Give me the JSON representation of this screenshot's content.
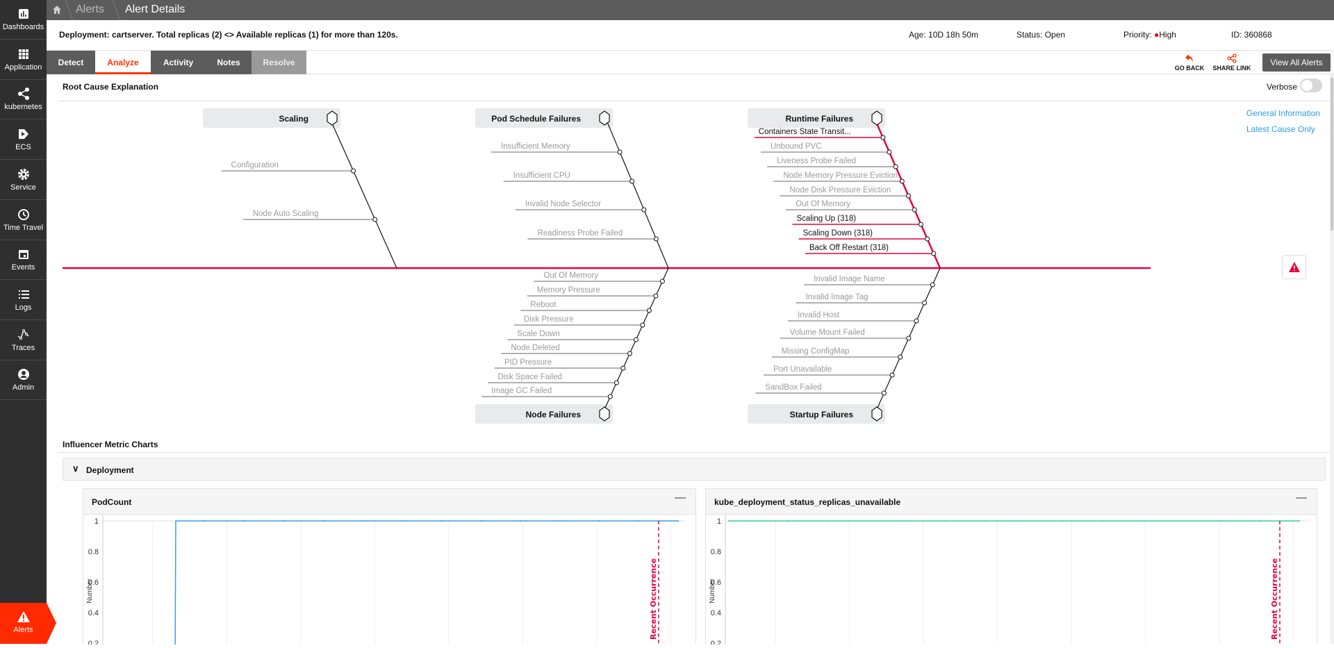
{
  "sidebar": {
    "items": [
      {
        "label": "Dashboards",
        "icon": "bar-chart-icon"
      },
      {
        "label": "Application",
        "icon": "grid-icon"
      },
      {
        "label": "kubernetes",
        "icon": "share-nodes-icon"
      },
      {
        "label": "ECS",
        "icon": "ecs-icon"
      },
      {
        "label": "Service",
        "icon": "gear-icon"
      },
      {
        "label": "Time Travel",
        "icon": "clock-rewind-icon"
      },
      {
        "label": "Events",
        "icon": "calendar-icon"
      },
      {
        "label": "Logs",
        "icon": "list-icon"
      },
      {
        "label": "Traces",
        "icon": "traces-icon"
      },
      {
        "label": "Admin",
        "icon": "user-circle-icon"
      }
    ],
    "active": {
      "label": "Alerts",
      "icon": "warning-icon",
      "color": "#ff2a00"
    }
  },
  "breadcrumb": {
    "items": [
      "Alerts",
      "Alert Details"
    ]
  },
  "alert": {
    "title": "Deployment: cartserver. Total replicas (2) <> Available replicas (1) for more than 120s.",
    "age": "Age: 10D 18h 50m",
    "status": "Status: Open",
    "priority_label": "Priority:",
    "priority": "High",
    "priority_color": "#e8001c",
    "id": "ID: 360868"
  },
  "tabs": [
    {
      "label": "Detect"
    },
    {
      "label": "Analyze",
      "active": true
    },
    {
      "label": "Activity"
    },
    {
      "label": "Notes"
    },
    {
      "label": "Resolve",
      "disabled": true
    }
  ],
  "actions": {
    "go_back": "GO BACK",
    "share_link": "SHARE LINK",
    "view_all": "View All Alerts"
  },
  "root_cause": {
    "title": "Root Cause Explanation",
    "verbose_label": "Verbose",
    "verbose_on": false,
    "links": [
      "General Information",
      "Latest Cause Only"
    ],
    "categories": {
      "scaling": {
        "title": "Scaling",
        "items": [
          {
            "label": "Configuration"
          },
          {
            "label": "Node Auto Scaling"
          }
        ]
      },
      "pod_schedule": {
        "title": "Pod Schedule Failures",
        "items": [
          {
            "label": "Insufficient Memory"
          },
          {
            "label": "Insufficient CPU"
          },
          {
            "label": "Invalid Node Selector"
          },
          {
            "label": "Readiness Probe Failed"
          }
        ]
      },
      "runtime": {
        "title": "Runtime Failures",
        "highlight": true,
        "items": [
          {
            "label": "Containers State Transit...",
            "active": true
          },
          {
            "label": "Unbound PVC"
          },
          {
            "label": "Liveness Probe Failed"
          },
          {
            "label": "Node Memory Pressure Eviction"
          },
          {
            "label": "Node Disk Pressure Eviction"
          },
          {
            "label": "Out Of Memory"
          },
          {
            "label": "Scaling Up (318)",
            "active": true
          },
          {
            "label": "Scaling Down (318)",
            "active": true
          },
          {
            "label": "Back Off Restart (318)",
            "active": true
          }
        ]
      },
      "node": {
        "title": "Node Failures",
        "items": [
          {
            "label": "Out Of Memory"
          },
          {
            "label": "Memory Pressure"
          },
          {
            "label": "Reboot"
          },
          {
            "label": "Disk Pressure"
          },
          {
            "label": "Scale Down"
          },
          {
            "label": "Node Deleted"
          },
          {
            "label": "PID Pressure"
          },
          {
            "label": "Disk Space Failed"
          },
          {
            "label": "Image GC Failed"
          }
        ]
      },
      "startup": {
        "title": "Startup Failures",
        "items": [
          {
            "label": "Invalid Image Name"
          },
          {
            "label": "Invalid Image Tag"
          },
          {
            "label": "Invalid Host"
          },
          {
            "label": "Volume Mount Failed"
          },
          {
            "label": "Missing ConfigMap"
          },
          {
            "label": "Port Unavailable"
          },
          {
            "label": "SandBox Failed"
          }
        ]
      }
    },
    "highlight_color": "#e8003c"
  },
  "influencer": {
    "title": "Influencer Metric Charts",
    "group": "Deployment"
  },
  "chart_data": [
    {
      "type": "line",
      "title": "PodCount",
      "ylabel": "Number",
      "yticks": [
        "1",
        "0.8",
        "0.6",
        "0.4",
        "0.2"
      ],
      "ylim": [
        0.2,
        1
      ],
      "grid": true,
      "color": "#3a9ee4",
      "values": [
        0,
        1,
        1,
        1,
        1,
        1,
        1,
        1,
        1,
        1,
        1,
        1,
        1,
        1
      ],
      "annotation": "Recent Occurrence",
      "annotation_color": "#e8003c"
    },
    {
      "type": "line",
      "title": "kube_deployment_status_replicas_unavailable",
      "ylabel": "Number",
      "yticks": [
        "1",
        "0.8",
        "0.6",
        "0.4",
        "0.2"
      ],
      "ylim": [
        0.2,
        1
      ],
      "grid": true,
      "color": "#2fd0a0",
      "values": [
        1,
        1,
        1,
        1,
        1,
        1,
        1,
        1,
        1,
        1,
        1,
        1,
        1,
        1
      ],
      "annotation": "Recent Occurrence",
      "annotation_color": "#e8003c"
    }
  ]
}
